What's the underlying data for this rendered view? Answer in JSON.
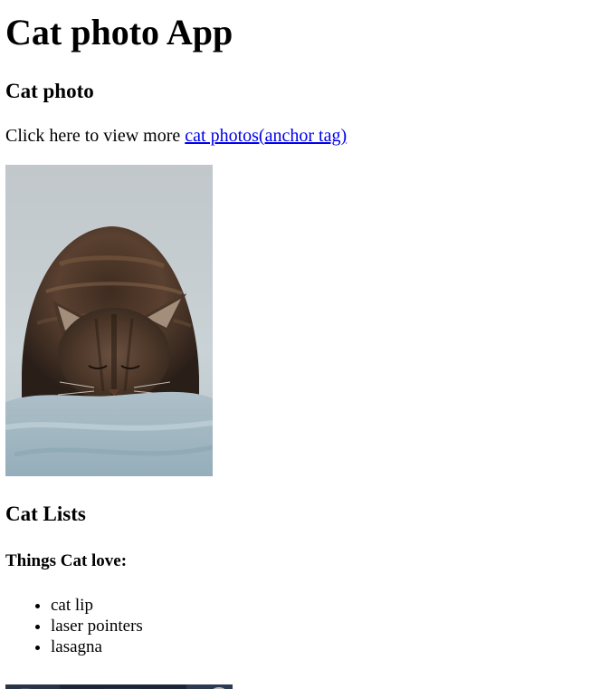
{
  "page": {
    "title": "Cat photo App",
    "section_title": "Cat photo",
    "intro_prefix": "Click here to view more ",
    "link_text": "cat photos(anchor tag)",
    "cat_image_icon": "cat-photo",
    "lists_title": "Cat Lists",
    "loves_heading": "Things Cat love:",
    "loves_items": [
      "cat lip",
      "laser pointers",
      "lasagna"
    ],
    "second_image_icon": "cat-photo"
  }
}
